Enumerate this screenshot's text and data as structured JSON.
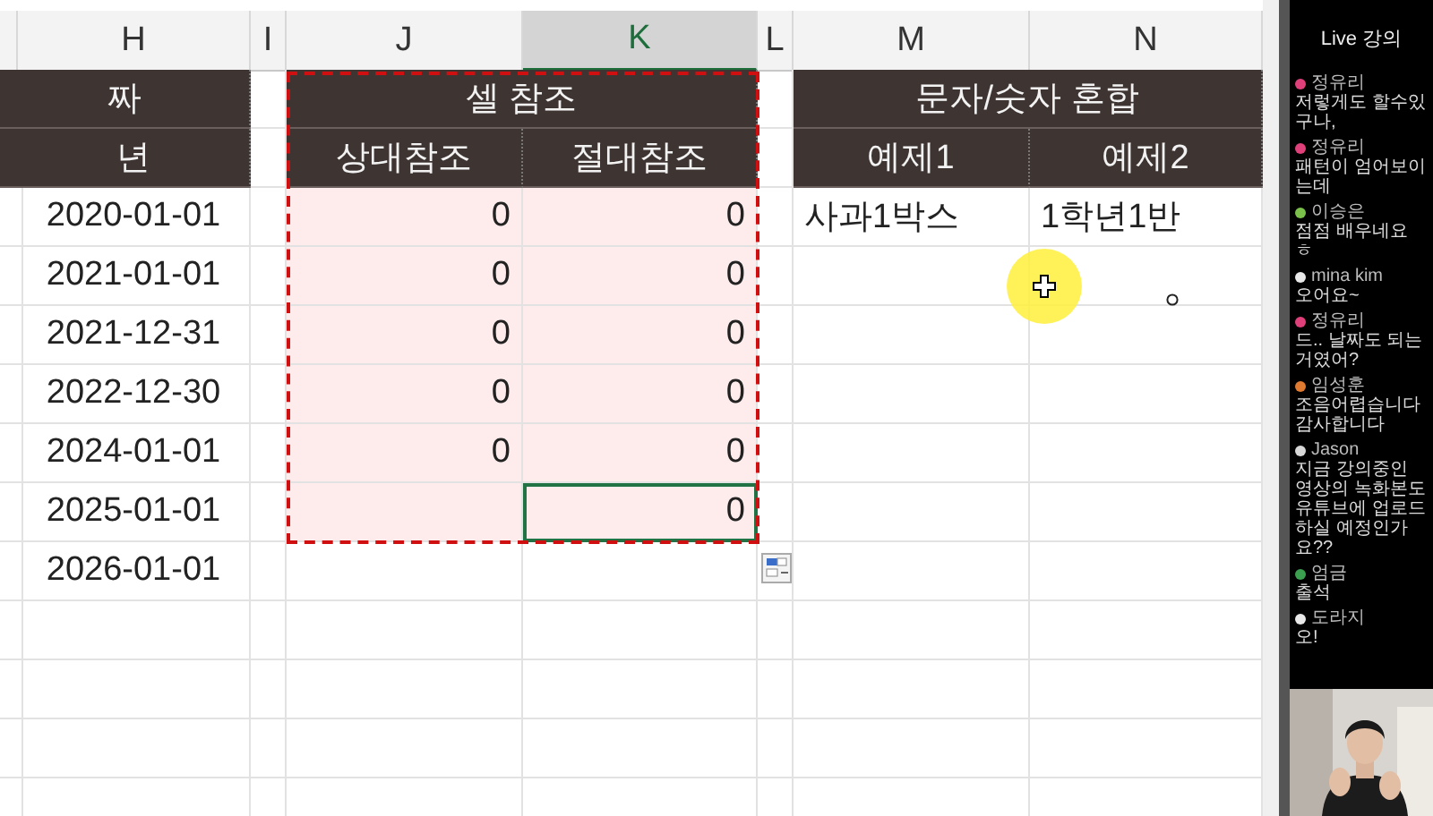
{
  "columns": [
    {
      "label": "H",
      "selected": false
    },
    {
      "label": "I",
      "selected": false
    },
    {
      "label": "J",
      "selected": false
    },
    {
      "label": "K",
      "selected": true
    },
    {
      "label": "L",
      "selected": false
    },
    {
      "label": "M",
      "selected": false
    },
    {
      "label": "N",
      "selected": false
    }
  ],
  "group_headers": {
    "date": "짜",
    "cell_reference": "셀 참조",
    "mixed": "문자/숫자 혼합"
  },
  "sub_headers": {
    "year": "년",
    "relative": "상대참조",
    "absolute": "절대참조",
    "example1": "예제1",
    "example2": "예제2"
  },
  "rows": [
    {
      "date": "2020-01-01",
      "relative": "0",
      "absolute": "0",
      "example1": "사과1박스",
      "example2": "1학년1반",
      "highlighted": true,
      "selected": false
    },
    {
      "date": "2021-01-01",
      "relative": "0",
      "absolute": "0",
      "highlighted": true,
      "selected": false
    },
    {
      "date": "2021-12-31",
      "relative": "0",
      "absolute": "0",
      "highlighted": true,
      "selected": false
    },
    {
      "date": "2022-12-30",
      "relative": "0",
      "absolute": "0",
      "highlighted": true,
      "selected": false
    },
    {
      "date": "2024-01-01",
      "relative": "0",
      "absolute": "0",
      "highlighted": true,
      "selected": false
    },
    {
      "date": "2025-01-01",
      "absolute": "0",
      "highlighted": true,
      "selected": true
    },
    {
      "date": "2026-01-01",
      "highlighted": false,
      "selected": false
    },
    {
      "highlighted": false,
      "selected": false
    },
    {
      "highlighted": false,
      "selected": false
    },
    {
      "highlighted": false,
      "selected": false
    },
    {
      "highlighted": false,
      "selected": false
    }
  ],
  "chat": {
    "title": "Live 강의",
    "messages": [
      {
        "name": "정유리",
        "text": "저렇게도 할수있구나,",
        "color": "#e0407a"
      },
      {
        "name": "정유리",
        "text": "패턴이 엄어보이는데",
        "color": "#e0407a"
      },
      {
        "name": "이승은",
        "text": "점점 배우네요 ㅎ",
        "color": "#7ac04a"
      },
      {
        "name": "mina kim",
        "text": "오어요~",
        "color": "#e8e8e8"
      },
      {
        "name": "정유리",
        "text": "드.. 날짜도 되는거였어?",
        "color": "#e0407a"
      },
      {
        "name": "임성훈",
        "text": "조음어렵습니다감사합니다",
        "color": "#e07a30"
      },
      {
        "name": "Jason",
        "text": "지금 강의중인 영상의 녹화본도 유튜브에 업로드 하실 예정인가요??",
        "color": "#d8d8d8"
      },
      {
        "name": "엄금",
        "text": "출석",
        "color": "#3aa050"
      },
      {
        "name": "도라지",
        "text": "오!",
        "color": "#e8e8e8"
      }
    ]
  }
}
